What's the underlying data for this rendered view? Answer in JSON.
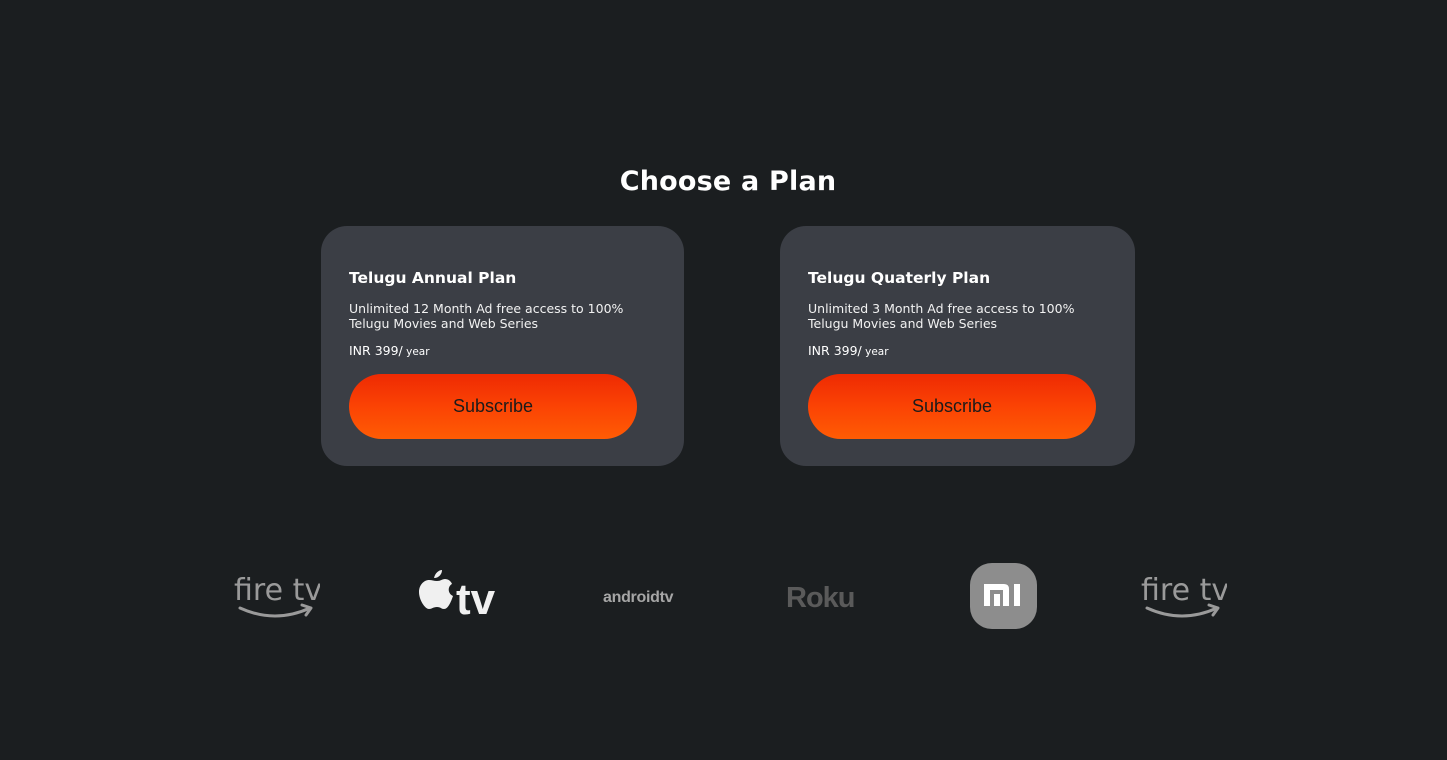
{
  "page": {
    "title": "Choose a Plan"
  },
  "plans": [
    {
      "name": "Telugu Annual Plan",
      "description": "Unlimited 12 Month Ad free access to 100% Telugu Movies and Web Series",
      "price": "INR 399/",
      "period": " year",
      "button_label": "Subscribe"
    },
    {
      "name": "Telugu Quaterly Plan",
      "description": "Unlimited 3 Month Ad free access to 100% Telugu Movies and Web Series",
      "price": "INR 399/",
      "period": " year",
      "button_label": "Subscribe"
    }
  ],
  "devices": {
    "firetv_1": "fire tv",
    "appletv": "tv",
    "androidtv": "androidtv",
    "roku": "Roku",
    "mi": "mi",
    "firetv_2": "fire tv"
  },
  "colors": {
    "background": "#1b1e20",
    "card": "#3b3e45",
    "accent_top": "#ee2a03",
    "accent_bottom": "#ff5c04",
    "logo_gray": "#9a9a9a"
  },
  "icons": [
    "firetv-logo-icon",
    "appletv-logo-icon",
    "androidtv-logo-icon",
    "roku-logo-icon",
    "mi-logo-icon"
  ]
}
